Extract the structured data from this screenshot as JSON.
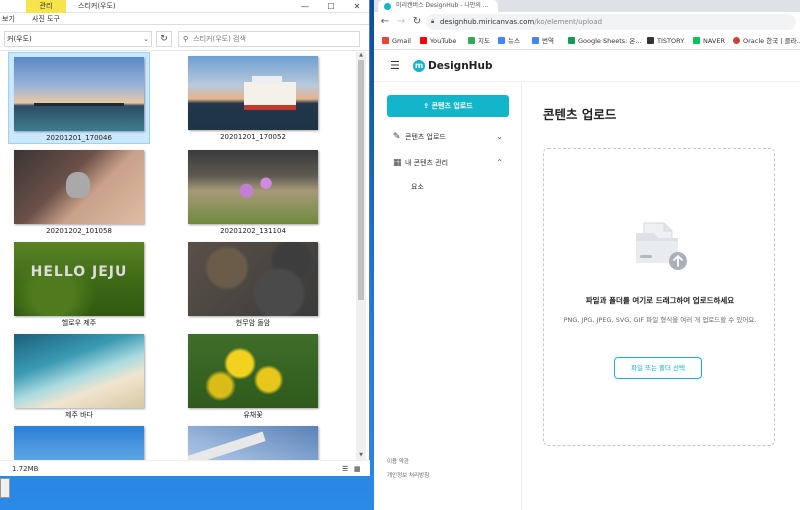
{
  "explorer": {
    "manage_tab": "관리",
    "title": "스티커(우도)",
    "ribbon": {
      "view_partial": "보기",
      "picture_tools": "사진 도구"
    },
    "address_value": "커(우도)",
    "search_placeholder": "스티커(우도) 검색",
    "files": [
      {
        "name": "20201201_170046",
        "selected": true
      },
      {
        "name": "20201201_170052",
        "selected": false
      },
      {
        "name": "20201202_101058",
        "selected": false
      },
      {
        "name": "20201202_131104",
        "selected": false
      },
      {
        "name": "헬로우 제주",
        "selected": false,
        "overlay": "HELLO JEJU"
      },
      {
        "name": "현무암 돌암",
        "selected": false
      },
      {
        "name": "제주 바다",
        "selected": false
      },
      {
        "name": "유채꽃",
        "selected": false
      },
      {
        "name": "",
        "selected": false
      },
      {
        "name": "",
        "selected": false
      }
    ],
    "status": {
      "size": "1.72MB"
    }
  },
  "browser": {
    "tab_title": "미리캔버스 DesignHub - 나만의 ...",
    "url_host": "designhub.miricanvas.com",
    "url_path": "/ko/element/upload",
    "bookmarks": [
      {
        "label": "Gmail",
        "color": "#ea4335"
      },
      {
        "label": "YouTube",
        "color": "#ff0000"
      },
      {
        "label": "지도",
        "color": "#34a853"
      },
      {
        "label": "뉴스",
        "color": "#4285f4"
      },
      {
        "label": "번역",
        "color": "#4285f4"
      },
      {
        "label": "Google Sheets: 온...",
        "color": "#0f9d58"
      },
      {
        "label": "TISTORY",
        "color": "#333333"
      },
      {
        "label": "NAVER",
        "color": "#03c75a"
      },
      {
        "label": "Oracle 한국 | 클라...",
        "color": "#c74634"
      }
    ]
  },
  "designhub": {
    "logo_mark": "m",
    "logo_text": "DesignHub",
    "sidebar": {
      "upload_button": "콘텐츠 업로드",
      "items": [
        {
          "label": "콘텐츠 업로드",
          "icon": "pencil-icon",
          "chevron": "⌄"
        },
        {
          "label": "내 콘텐츠 관리",
          "icon": "grid-icon",
          "chevron": "⌃"
        }
      ],
      "sub_items": [
        "요소"
      ],
      "footer": {
        "terms": "이용 약관",
        "privacy": "개인정보 처리방침"
      }
    },
    "main": {
      "title": "콘텐츠 업로드",
      "dropzone_title": "파일과 폴더를 여기로 드래그하여 업로드하세요",
      "dropzone_desc": "PNG, JPG, JPEG, SVG, GIF 파일 형식을 여러 개 업로드할 수 있어요.",
      "select_button": "파일 또는 폴더 선택"
    },
    "accent_color": "#12b5c9"
  }
}
